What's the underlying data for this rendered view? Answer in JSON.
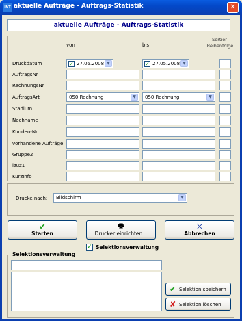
{
  "window": {
    "icon_text": "INT",
    "title": "aktuelle Aufträge  -  Auftrags-Statistik",
    "close_glyph": "✕"
  },
  "header": {
    "title": "aktuelle Aufträge  -  Auftrags-Statistik"
  },
  "columns": {
    "from": "von",
    "to": "bis",
    "sort_line1": "Sortier-",
    "sort_line2": "Reihenfolge"
  },
  "fields": {
    "druckdatum": {
      "label": "Druckdatum",
      "from_value": "27.05.2008",
      "to_value": "27.05.2008",
      "from_checked": "✓",
      "to_checked": "✓"
    },
    "auftragsnr": {
      "label": "AuftragsNr"
    },
    "rechnungsnr": {
      "label": "RechnungsNr"
    },
    "auftragsart": {
      "label": "AuftragsArt",
      "from_value": "050 Rechnung",
      "to_value": "050 Rechnung"
    },
    "stadium": {
      "label": "Stadium"
    },
    "nachname": {
      "label": "Nachname"
    },
    "kundennr": {
      "label": "Kunden-Nr"
    },
    "vorhandene_auftraege": {
      "label": "vorhandene Aufträge"
    },
    "gruppe2": {
      "label": "Gruppe2"
    },
    "izuz1": {
      "label": "izuz1"
    },
    "kurzinfo": {
      "label": "KurzInfo"
    }
  },
  "print": {
    "label": "Drucke nach:",
    "value": "Bildschirm"
  },
  "buttons": {
    "start": "Starten",
    "printer": "Drucker einrichten...",
    "cancel": "Abbrechen",
    "save_selection": "Selektion speichern",
    "delete_selection": "Selektion löschen"
  },
  "selection": {
    "checkbox_label": "Selektionsverwaltung",
    "checked": "✓",
    "group_title": "Selektionsverwaltung",
    "input_value": ""
  },
  "colors": {
    "title_blue": "#0b3fb0",
    "header_text": "#00008b",
    "accent_green": "#21a121",
    "accent_red": "#d01818"
  },
  "icons": {
    "start": "green-check-icon",
    "printer": "printer-icon",
    "cancel": "exit-door-icon",
    "save": "green-check-icon",
    "delete": "red-x-icon",
    "combo": "chevron-down-icon"
  }
}
